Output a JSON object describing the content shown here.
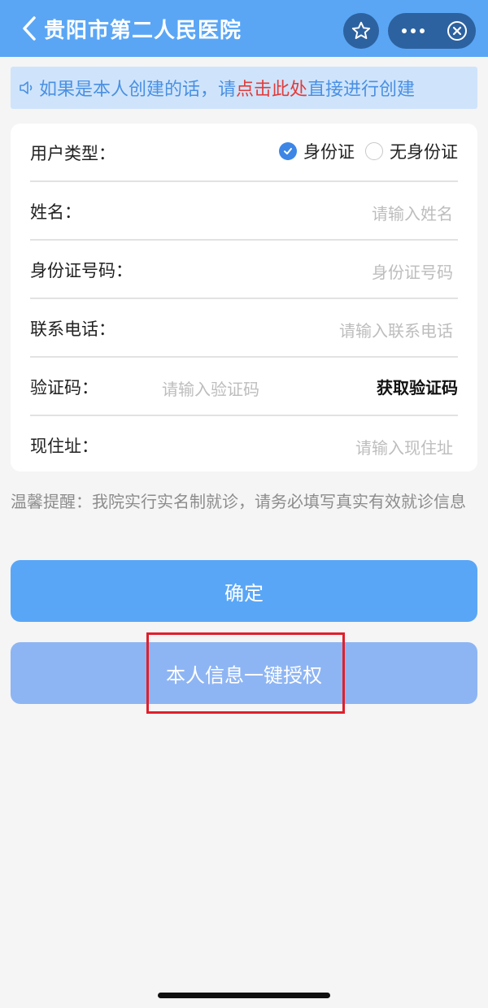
{
  "header": {
    "title": "贵阳市第二人民医院",
    "back_icon": "chevron-left-icon",
    "star_icon": "star-icon",
    "more_icon": "more-dots-icon",
    "close_icon": "close-circle-icon"
  },
  "notice": {
    "icon": "speaker-icon",
    "text_before": "如果是本人创建的话，请",
    "link_text": "点击此处",
    "text_after": "直接进行创建"
  },
  "form": {
    "user_type": {
      "label": "用户类型：",
      "options": [
        {
          "label": "身份证",
          "selected": true
        },
        {
          "label": "无身份证",
          "selected": false
        }
      ]
    },
    "name": {
      "label": "姓名：",
      "placeholder": "请输入姓名"
    },
    "id_number": {
      "label": "身份证号码：",
      "placeholder": "身份证号码"
    },
    "phone": {
      "label": "联系电话：",
      "placeholder": "请输入联系电话"
    },
    "code": {
      "label": "验证码：",
      "placeholder": "请输入验证码",
      "action_label": "获取验证码"
    },
    "address": {
      "label": "现住址：",
      "placeholder": "请输入现住址"
    }
  },
  "tip": "温馨提醒：我院实行实名制就诊，请务必填写真实有效就诊信息",
  "buttons": {
    "confirm": "确定",
    "authorize": "本人信息一键授权"
  },
  "colors": {
    "header": "#5aa6f5",
    "accent": "#3d86e6",
    "link": "#e23b3b",
    "highlight": "#e01f2b"
  }
}
